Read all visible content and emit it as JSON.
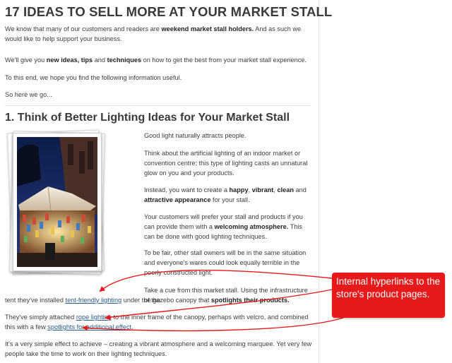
{
  "article": {
    "title": "17 IDEAS TO SELL MORE AT YOUR MARKET STALL",
    "intro1": {
      "a": "We know that many of our customers and readers are ",
      "b": "weekend market stall holders.",
      "c": " And as such we would like to help support your business."
    },
    "intro2": {
      "a": "We'll give you ",
      "b": "new ideas, tips",
      "c": " and ",
      "d": "techniques",
      "e": " on how to get the best from your market stall experience."
    },
    "intro3": "To this end, we hope you find the following information useful.",
    "intro4": "So here we go...",
    "section1_title": "1. Think of Better Lighting Ideas for Your Market Stall",
    "s1p1": "Good light naturally attracts people.",
    "s1p2": "Think about the artificial lighting of an indoor market or convention centre; this type of lighting casts an unnatural glow on you and your products.",
    "s1p3": {
      "a": "Instead, you want to create a ",
      "b": "happy",
      "c": ", ",
      "d": "vibrant",
      "e": ", ",
      "f": "clean",
      "g": " and ",
      "h": "attractive appearance",
      "i": " for your stall."
    },
    "s1p4": {
      "a": "Your customers will prefer your stall and products if you can provide them with a ",
      "b": "welcoming atmosphere.",
      "c": " This can be done with good lighting techniques."
    },
    "s1p5": "To be fair, other stall owners will be in the same situation and everyone's wares could look equally terrible in the poorly constructed light.",
    "s1p6": {
      "a": "Take a cue from this market stall. Using the infrastructure of the",
      "b": "tent they've installed ",
      "link": "tent-friendly lighting",
      "c": " under the gazebo canopy that ",
      "d": "spotlights their products."
    },
    "s1p7": {
      "a": "They've simply attached ",
      "link1": "rope lighting",
      "b": " to the inner frame of the canopy, perhaps with velcro, and combined this with a few ",
      "link2": "spotlights for additional effect",
      "c": "."
    },
    "s1p8": "It's a very simple effect to achieve – creating a vibrant atmosphere and a welcoming marquee. Yet very few people take the time to work on their lighting techniques."
  },
  "callout": {
    "text": "Internal hyperlinks to the store's product pages."
  },
  "colors": {
    "link": "#2a5b8a",
    "callout_bg": "#e8191a",
    "arrow": "#e8191a",
    "heading": "#3a3a3a"
  }
}
